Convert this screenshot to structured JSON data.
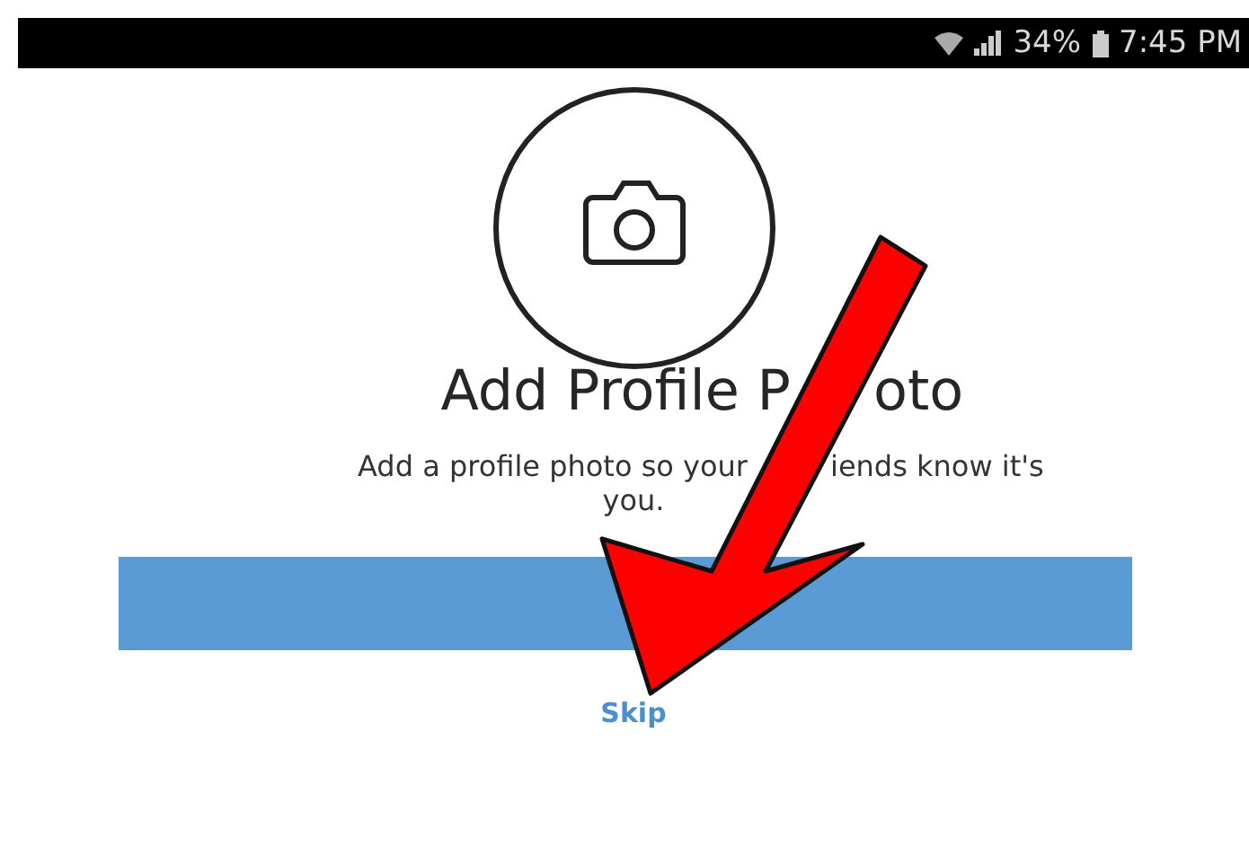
{
  "status_bar": {
    "battery": "34%",
    "time": "7:45 PM"
  },
  "title": [
    "Add Profile P",
    "oto"
  ],
  "subtitle": [
    [
      "Add a profile photo so your",
      "iends know it's"
    ],
    [
      "you."
    ]
  ],
  "skip": "Skip"
}
